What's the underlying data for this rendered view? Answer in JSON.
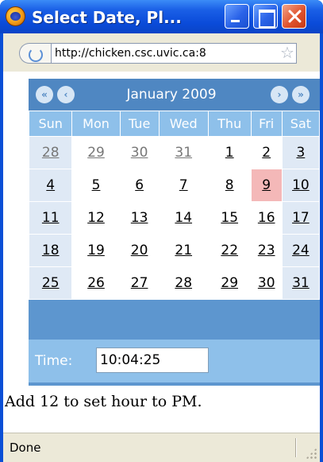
{
  "window": {
    "title": "Select Date, Pl..."
  },
  "browser": {
    "url": "http://chicken.csc.uvic.ca:8",
    "status": "Done"
  },
  "calendar": {
    "nav": {
      "prev_year": "«",
      "prev_month": "‹",
      "next_month": "›",
      "next_year": "»"
    },
    "month_label": "January 2009",
    "weekdays": [
      "Sun",
      "Mon",
      "Tue",
      "Wed",
      "Thu",
      "Fri",
      "Sat"
    ],
    "weeks": [
      [
        "28",
        "29",
        "30",
        "31",
        "1",
        "2",
        "3"
      ],
      [
        "4",
        "5",
        "6",
        "7",
        "8",
        "9",
        "10"
      ],
      [
        "11",
        "12",
        "13",
        "14",
        "15",
        "16",
        "17"
      ],
      [
        "18",
        "19",
        "20",
        "21",
        "22",
        "23",
        "24"
      ],
      [
        "25",
        "26",
        "27",
        "28",
        "29",
        "30",
        "31"
      ]
    ],
    "today": "9",
    "time_label": "Time:",
    "time_value": "10:04:25"
  },
  "hint": "Add 12 to set hour to PM.",
  "colors": {
    "title_bar": "#0a4bd9",
    "calendar_header": "#4f87c2",
    "weekday_header": "#8ec0ea",
    "weekend_cell": "#dfe9f5",
    "today_cell": "#f4b8b8"
  }
}
